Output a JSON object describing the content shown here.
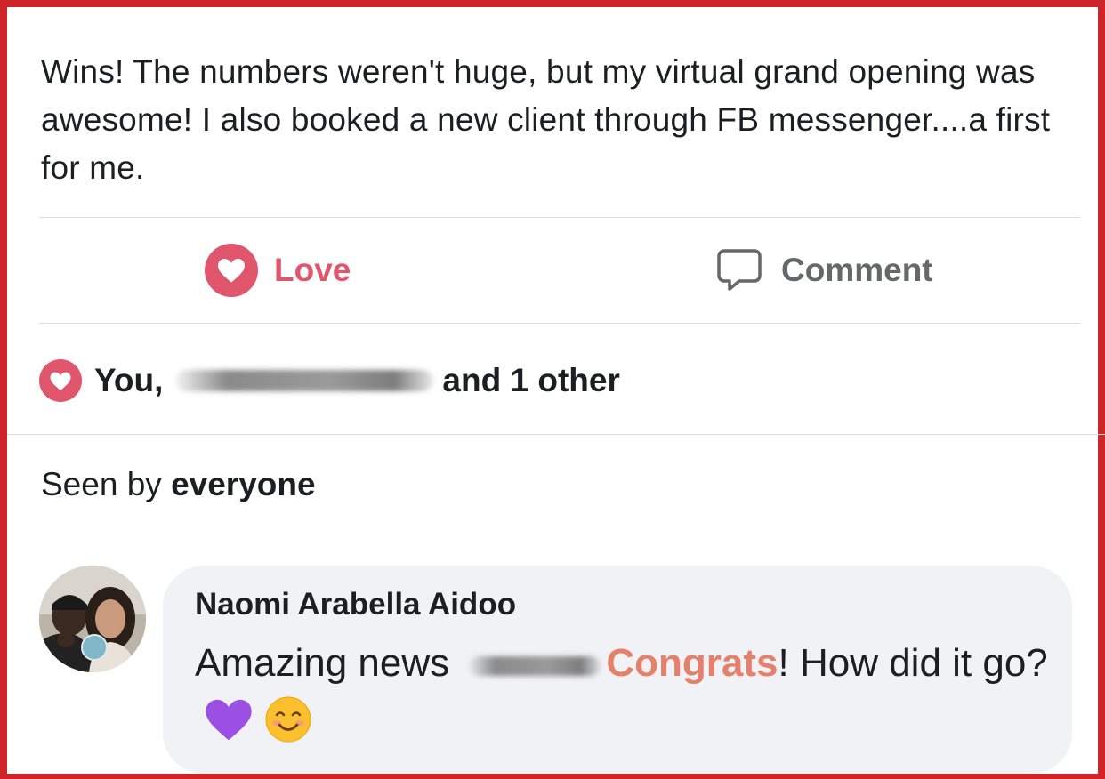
{
  "post": {
    "text": "Wins! The numbers weren't huge, but my virtual grand opening was awesome! I also booked a new client through FB messenger....a first for me."
  },
  "actions": {
    "love_label": "Love",
    "comment_label": "Comment"
  },
  "reactions": {
    "you": "You,",
    "others": "and 1 other"
  },
  "seen": {
    "prefix": "Seen by",
    "audience": "everyone"
  },
  "comment": {
    "author": "Naomi Arabella Aidoo",
    "text_before": "Amazing news",
    "highlight": "Congrats",
    "text_after": "! How did it go?",
    "emojis": [
      "purple-heart",
      "smiling-face"
    ]
  },
  "colors": {
    "love": "#e0566d",
    "frame": "#d0242b",
    "highlight": "#e5806a",
    "bubble": "#f0f2f5"
  }
}
